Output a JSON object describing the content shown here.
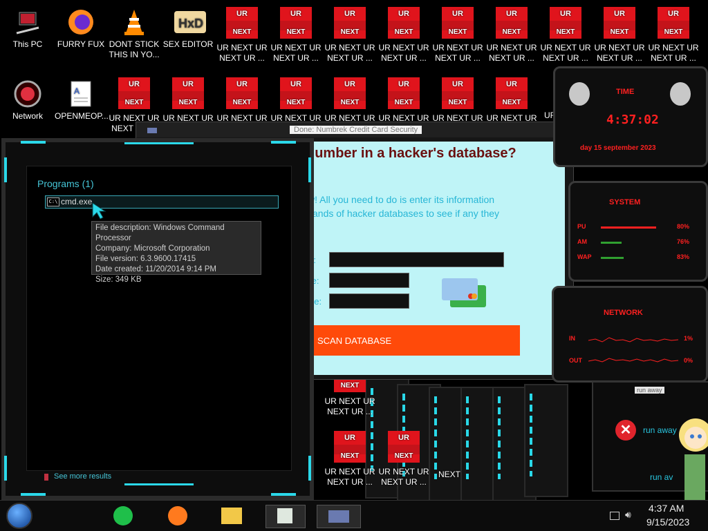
{
  "desktop": {
    "icons_row1": [
      {
        "label_l1": "This PC",
        "label_l2": ""
      },
      {
        "label_l1": "FURRY FUX",
        "label_l2": ""
      },
      {
        "label_l1": "DONT STICK",
        "label_l2": "THIS IN YO..."
      },
      {
        "label_l1": "SEX EDITOR",
        "label_l2": ""
      }
    ],
    "icons_row2": [
      {
        "label_l1": "Network",
        "label_l2": ""
      },
      {
        "label_l1": "OPENMEOP...",
        "label_l2": ""
      }
    ],
    "ur_tile": {
      "top": "UR",
      "bottom": "NEXT"
    },
    "ur_label_l1": "UR NEXT UR",
    "ur_label_l2": "NEXT UR ...",
    "ur_label_clip_l2": "NEXT",
    "ur_label_clip_l1": "UF"
  },
  "scam_window": {
    "title": "Done: Numbrek Credit Card Security",
    "heading": "number in a hacker's database?",
    "para_l1": "w! All you need to do is enter its information",
    "para_l2": "sands of hacker databases to see if any they",
    "label1": "r:",
    "label2": "te:",
    "label3": "de:",
    "scan_button": "SCAN DATABASE"
  },
  "start_menu": {
    "section_title": "Programs (1)",
    "result": "cmd.exe",
    "tooltip": {
      "l1": "File description: Windows Command Processor",
      "l2": "Company: Microsoft Corporation",
      "l3": "File version: 6.3.9600.17415",
      "l4": "Date created: 11/20/2014 9:14 PM",
      "l5": "Size: 349 KB"
    },
    "see_more": "See more results"
  },
  "gadgets": {
    "time": {
      "title": "TIME",
      "clock": "4:37:02",
      "date": "day 15 september 2023"
    },
    "system": {
      "title": "SYSTEM",
      "cpu_label": "PU",
      "cpu_value": "80%",
      "ram_label": "AM",
      "ram_value": "76%",
      "swap_label": "WAP",
      "swap_value": "83%",
      "cpu_fill": 0.8,
      "ram_fill": 0.76,
      "swap_fill": 0.83
    },
    "network": {
      "title": "NETWORK",
      "in_label": "IN",
      "in_value": "1%",
      "out_label": "OUT",
      "out_value": "0%"
    }
  },
  "error_dialog": {
    "title": "run away",
    "message": "run away",
    "button": "run av"
  },
  "taskbar": {
    "time": "4:37 AM",
    "date": "9/15/2023"
  },
  "colors": {
    "accent_cyan": "#2bd9ea",
    "ur_red": "#e0141c",
    "scan_orange": "#ff4a0a",
    "gadget_red": "#ff2020"
  }
}
